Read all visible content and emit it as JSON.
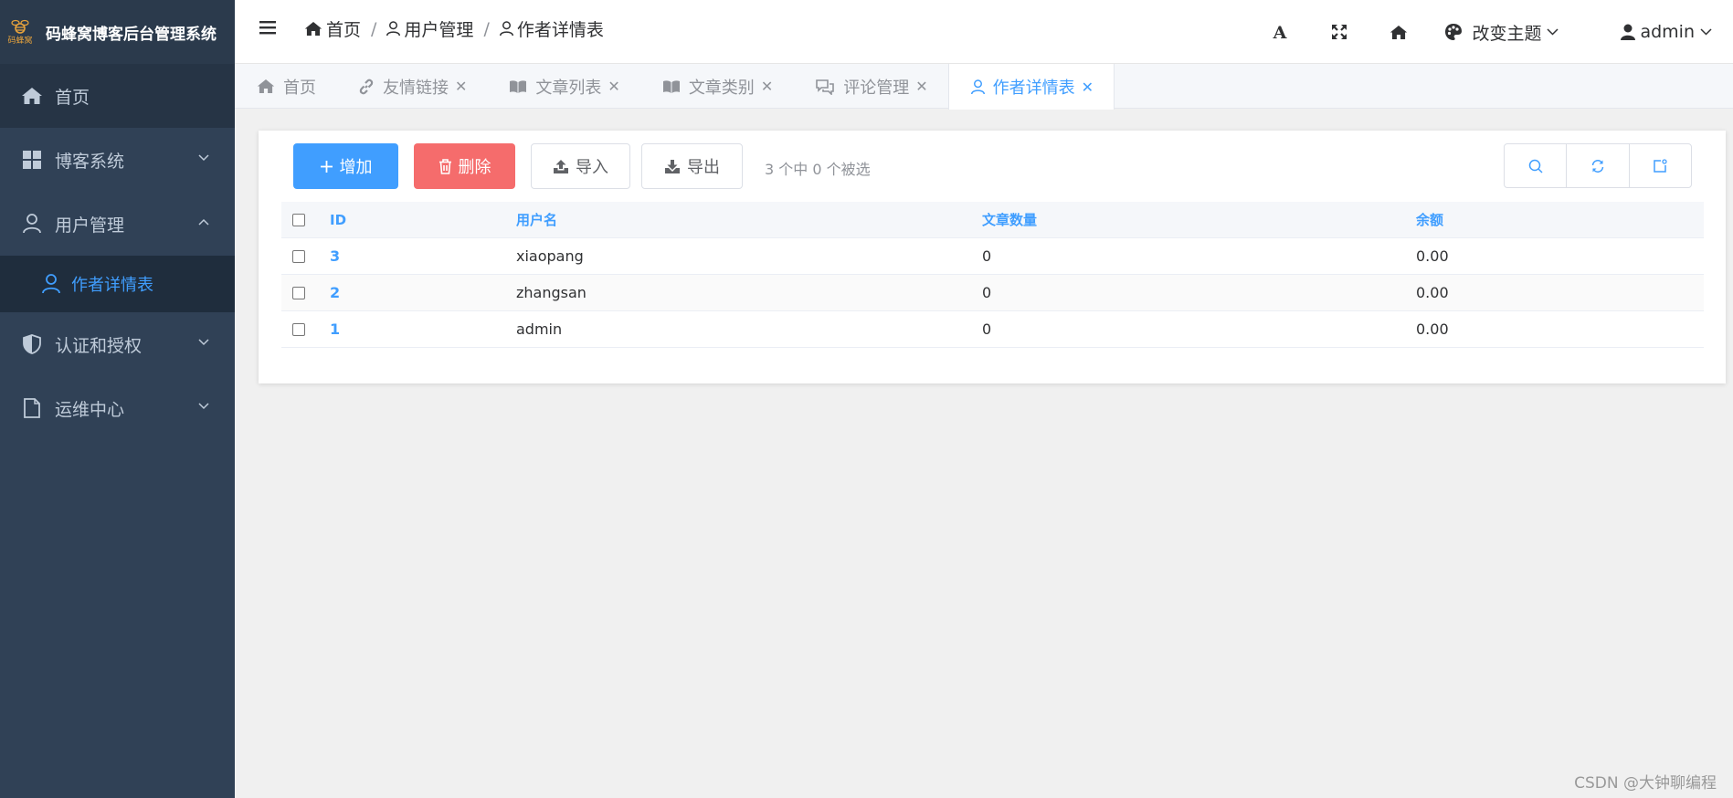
{
  "app": {
    "logo_text": "码蜂窝",
    "title": "码蜂窝博客后台管理系统"
  },
  "sidebar": {
    "items": [
      {
        "label": "首页",
        "icon": "home-icon"
      },
      {
        "label": "博客系统",
        "icon": "grid-icon",
        "expanded": false
      },
      {
        "label": "用户管理",
        "icon": "user-icon",
        "expanded": true
      },
      {
        "label": "认证和授权",
        "icon": "shield-icon",
        "expanded": false
      },
      {
        "label": "运维中心",
        "icon": "document-icon",
        "expanded": false
      }
    ],
    "active_subitem": {
      "label": "作者详情表",
      "icon": "user-icon"
    }
  },
  "header": {
    "breadcrumb": [
      {
        "label": "首页",
        "icon": "home-icon"
      },
      {
        "label": "用户管理",
        "icon": "user-icon"
      },
      {
        "label": "作者详情表",
        "icon": "user-icon"
      }
    ],
    "theme_label": "改变主题",
    "user_label": "admin",
    "tools": [
      "font-size-icon",
      "fullscreen-icon",
      "home-icon"
    ]
  },
  "tabs": [
    {
      "label": "首页",
      "icon": "home-icon",
      "closable": false,
      "active": false
    },
    {
      "label": "友情链接",
      "icon": "link-icon",
      "closable": true,
      "active": false
    },
    {
      "label": "文章列表",
      "icon": "book-icon",
      "closable": true,
      "active": false
    },
    {
      "label": "文章类别",
      "icon": "book-icon",
      "closable": true,
      "active": false
    },
    {
      "label": "评论管理",
      "icon": "comment-icon",
      "closable": true,
      "active": false
    },
    {
      "label": "作者详情表",
      "icon": "user-icon",
      "closable": true,
      "active": true
    }
  ],
  "toolbar": {
    "add_label": "增加",
    "delete_label": "删除",
    "import_label": "导入",
    "export_label": "导出",
    "selection_info": "3 个中 0 个被选"
  },
  "table": {
    "columns": [
      "ID",
      "用户名",
      "文章数量",
      "余额"
    ],
    "rows": [
      {
        "id": "3",
        "username": "xiaopang",
        "articles": "0",
        "balance": "0.00"
      },
      {
        "id": "2",
        "username": "zhangsan",
        "articles": "0",
        "balance": "0.00"
      },
      {
        "id": "1",
        "username": "admin",
        "articles": "0",
        "balance": "0.00"
      }
    ]
  },
  "watermark": "CSDN @大钟聊编程",
  "colors": {
    "primary": "#409eff",
    "danger": "#f56c6c",
    "sidebar": "#304156",
    "logo_gold": "#e6a23c"
  }
}
